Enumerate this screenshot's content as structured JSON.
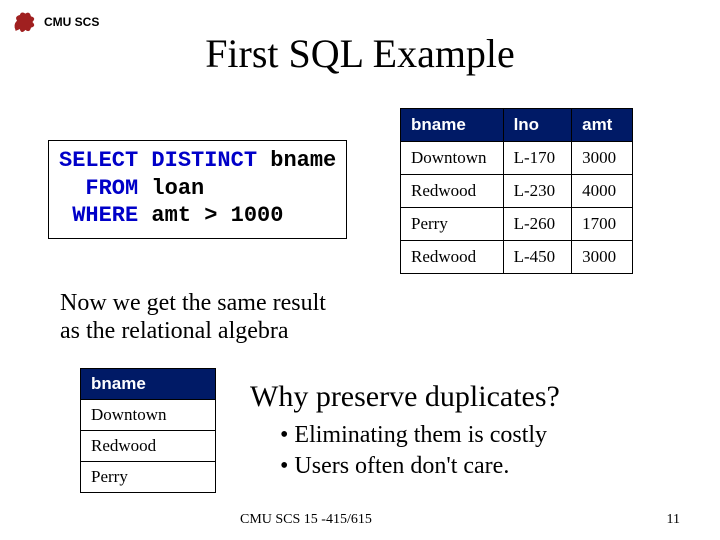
{
  "header": {
    "dept": "CMU SCS"
  },
  "title": "First SQL Example",
  "sql": {
    "l1a": "SELECT",
    "l1b": " ",
    "l1c": "DISTINCT",
    "l1d": " bname",
    "l2a": "  FROM",
    "l2b": " loan",
    "l3a": " WHERE",
    "l3b": " amt > 1000"
  },
  "loan_table": {
    "headers": {
      "c0": "bname",
      "c1": "lno",
      "c2": "amt"
    },
    "rows": [
      {
        "c0": "Downtown",
        "c1": "L-170",
        "c2": "3000"
      },
      {
        "c0": "Redwood",
        "c1": "L-230",
        "c2": "4000"
      },
      {
        "c0": "Perry",
        "c1": "L-260",
        "c2": "1700"
      },
      {
        "c0": "Redwood",
        "c1": "L-450",
        "c2": "3000"
      }
    ]
  },
  "note_line1": "Now we get the same result",
  "note_line2": "as the relational algebra",
  "result_table": {
    "header": "bname",
    "rows": [
      "Downtown",
      "Redwood",
      "Perry"
    ]
  },
  "question": "Why preserve duplicates?",
  "bullet1": "• Eliminating them is costly",
  "bullet2": "• Users often don't care.",
  "footer": {
    "course": "CMU SCS 15 -415/615",
    "page": "11"
  }
}
